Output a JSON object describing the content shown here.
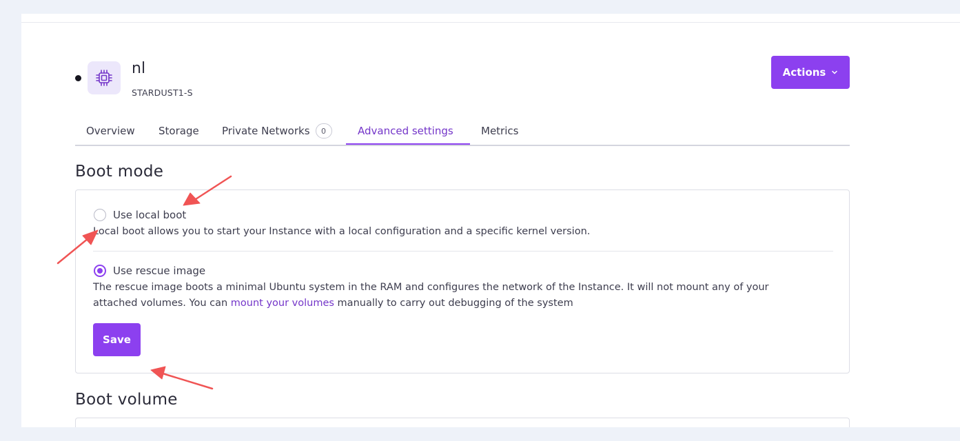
{
  "instance": {
    "name": "nl",
    "type": "STARDUST1-S",
    "icon": "cpu-chip-icon"
  },
  "header": {
    "actions_label": "Actions"
  },
  "tabs": [
    {
      "label": "Overview"
    },
    {
      "label": "Storage"
    },
    {
      "label": "Private Networks",
      "badge": "0"
    },
    {
      "label": "Advanced settings",
      "active": true
    },
    {
      "label": "Metrics"
    }
  ],
  "boot_mode": {
    "title": "Boot mode",
    "local_boot": {
      "label": "Use local boot",
      "checked": false,
      "description": "Local boot allows you to start your Instance with a local configuration and a specific kernel version."
    },
    "rescue_image": {
      "label": "Use rescue image",
      "checked": true,
      "description_line1": "The rescue image boots a minimal Ubuntu system in the RAM and configures the network of the Instance. It will not mount any of your",
      "description_line2_before": "attached volumes. You can ",
      "description_link": "mount your volumes",
      "description_line2_after": " manually to carry out debugging of the system"
    },
    "save_label": "Save"
  },
  "boot_volume": {
    "title": "Boot volume"
  },
  "colors": {
    "accent": "#8c40ef",
    "accent_text": "#7436c9",
    "annotation_arrow": "#f05454",
    "background": "#eef2f9"
  }
}
